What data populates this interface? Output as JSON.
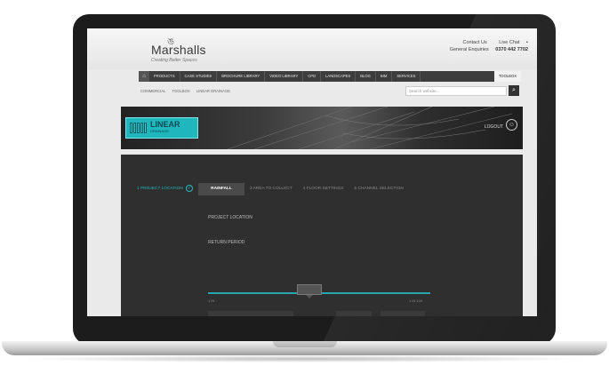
{
  "site": {
    "logo_text": "Marshalls",
    "logo_tagline": "Creating Better Spaces",
    "contact_us": "Contact Us",
    "live_chat": "Live Chat",
    "general_enquiries_label": "General Enquiries",
    "phone": "0370 442 7702"
  },
  "nav": {
    "items": [
      "PRODUCTS",
      "CASE STUDIES",
      "BROCHURE LIBRARY",
      "VIDEO LIBRARY",
      "CPD",
      "LANDSCAPES",
      "BLOG",
      "BIM",
      "SERVICES"
    ],
    "active": "TOOLBOX"
  },
  "breadcrumb": [
    "COMMERCIAL",
    "TOOLBOX",
    "LINEAR DRAINAGE"
  ],
  "search": {
    "placeholder": "Search website..."
  },
  "banner": {
    "brand_word": "LINEAR",
    "brand_sub": "DRAINAGE",
    "logout": "LOGOUT"
  },
  "steps": [
    {
      "label": "1 PROJECT LOCATION",
      "state": "done"
    },
    {
      "label": "RAINFALL",
      "state": "current"
    },
    {
      "label": "3 AREA TO COLLECT",
      "state": "todo"
    },
    {
      "label": "4 FLOOR SETTINGS",
      "state": "todo"
    },
    {
      "label": "5 CHANNEL SELECTION",
      "state": "todo"
    }
  ],
  "form": {
    "project_location_label": "PROJECT LOCATION",
    "project_location_value": "",
    "project_location_metric": "",
    "return_period_label": "RETURN PERIOD",
    "return_period_metric": "",
    "scale_min": "1 IN",
    "scale_max": "1 IN 100",
    "slider_value_text": ""
  },
  "colors": {
    "accent": "#26b8c0",
    "panel": "#2f2f2f",
    "nav": "#3d3d3d"
  }
}
